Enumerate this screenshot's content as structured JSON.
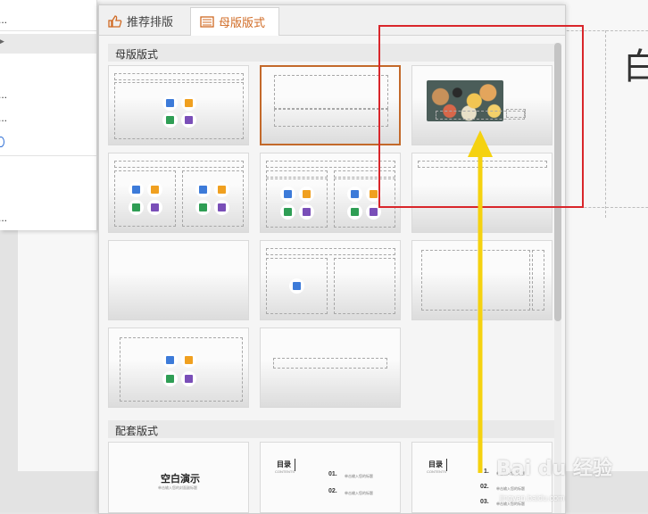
{
  "tabs": {
    "recommended": "推荐排版",
    "master": "母版版式"
  },
  "sections": {
    "master_layouts": "母版版式",
    "matching_layouts": "配套版式"
  },
  "context_menu": [
    "...",
    "...",
    "...",
    "..."
  ],
  "background_char": "白",
  "thumbs": {
    "blank_title": "空白演示",
    "blank_sub": "单击输入您的封面副标题",
    "toc_title": "目录",
    "toc_sub": "CONTENTS",
    "toc_items": [
      "01.",
      "02."
    ],
    "toc_text": "单击输入您的标题",
    "toc_items_b": [
      "1.",
      "02.",
      "03."
    ]
  },
  "watermark": {
    "main": "Bai du 经验",
    "sub": "jingyan.baidu.com"
  },
  "colors": {
    "accent": "#d06a23",
    "red_box": "#d9262b",
    "arrow": "#f5d20f"
  }
}
